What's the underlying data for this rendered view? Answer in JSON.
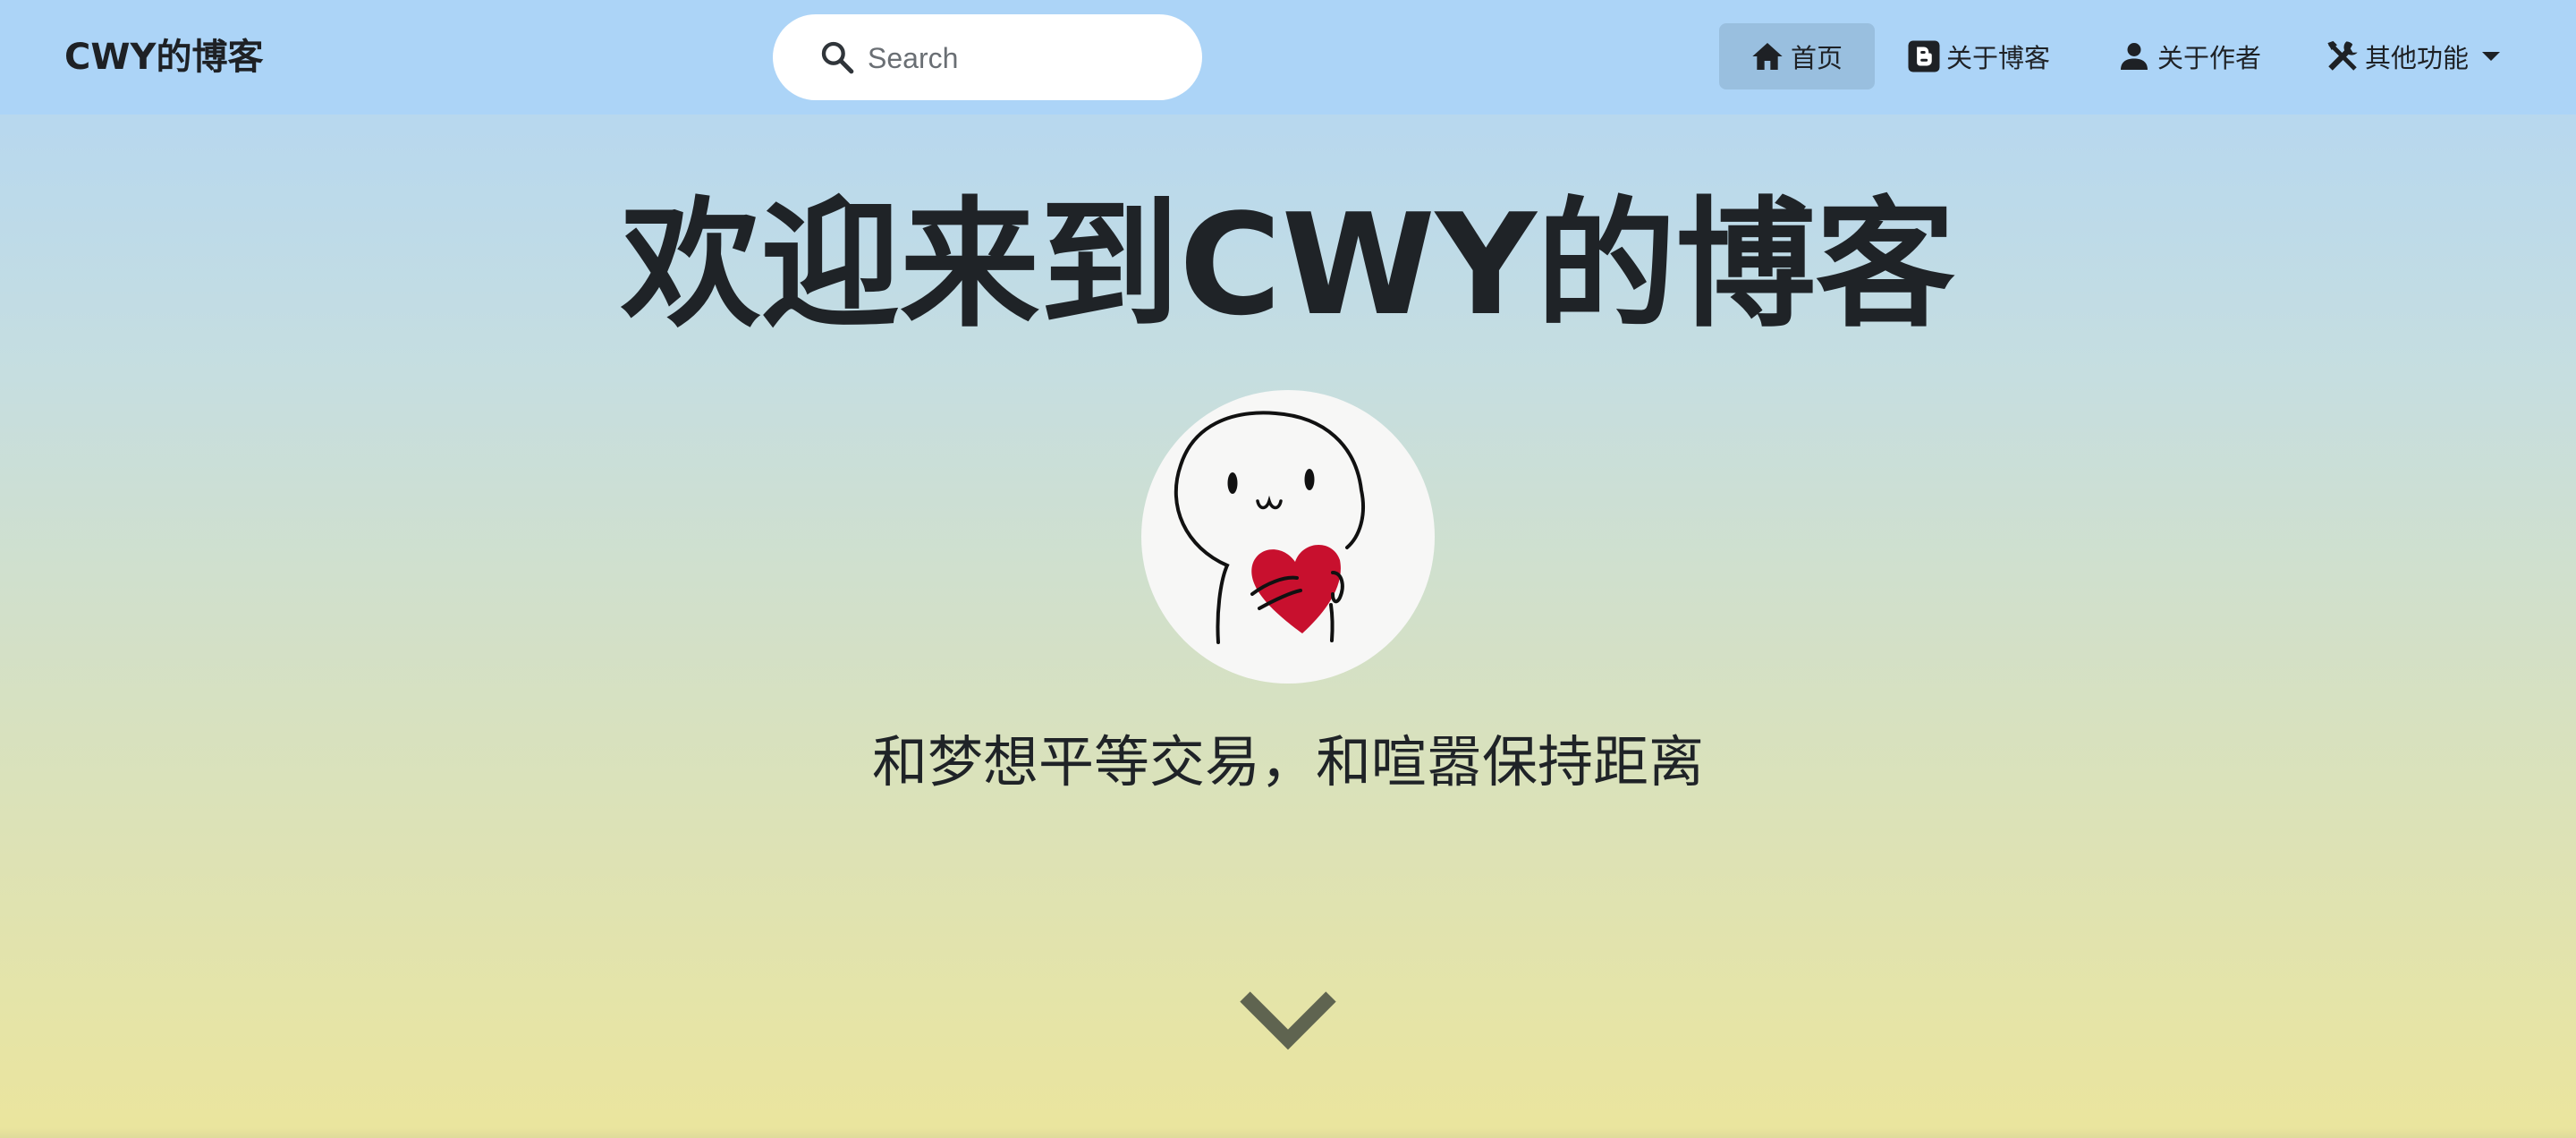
{
  "navbar": {
    "brand": "CWY的博客",
    "search": {
      "placeholder": "Search",
      "value": ""
    },
    "items": [
      {
        "label": "首页",
        "icon": "home-icon",
        "active": true
      },
      {
        "label": "关于博客",
        "icon": "blogger-icon"
      },
      {
        "label": "关于作者",
        "icon": "user-icon"
      },
      {
        "label": "其他功能",
        "icon": "tools-icon",
        "dropdown": true
      }
    ]
  },
  "hero": {
    "title": "欢迎来到CWY的博客",
    "avatar": "avatar-cartoon-heart",
    "motto": "和梦想平等交易，和喧嚣保持距离",
    "scroll_icon": "chevron-down-icon"
  },
  "colors": {
    "navbar_bg": "#acd4f7",
    "nav_active_bg": "#99bfdf",
    "gradient_top": "#b1d5f5",
    "gradient_bottom": "#ebe59d",
    "heart": "#c8102e",
    "chevron": "#5f6450"
  }
}
